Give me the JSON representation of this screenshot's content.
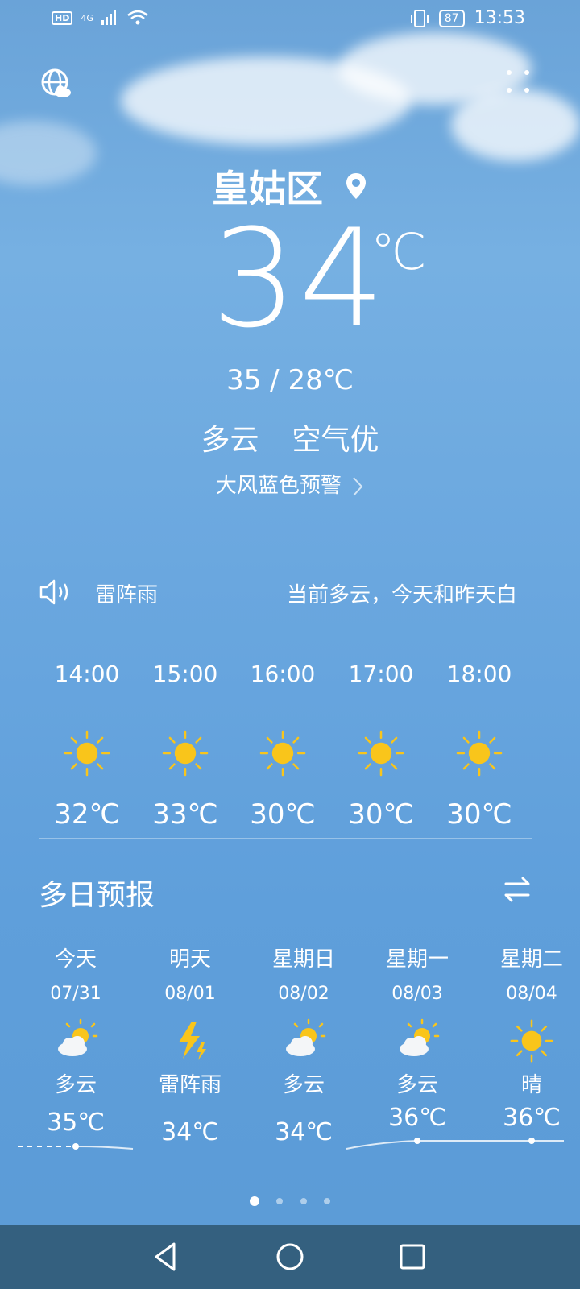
{
  "status": {
    "network_badge": "HD",
    "network_type": "4G",
    "battery": "87",
    "time": "13:53"
  },
  "location": {
    "city": "皇姑区"
  },
  "current": {
    "temp": "34",
    "unit": "℃",
    "range": "35 / 28℃",
    "condition": "多云",
    "air": "空气优",
    "alert": "大风蓝色预警"
  },
  "ticker": {
    "segment1": "雷阵雨",
    "segment2": "当前多云，今天和昨天白"
  },
  "hourly": [
    {
      "time": "14:00",
      "icon": "sun-icon",
      "temp": "32℃"
    },
    {
      "time": "15:00",
      "icon": "sun-icon",
      "temp": "33℃"
    },
    {
      "time": "16:00",
      "icon": "sun-icon",
      "temp": "30℃"
    },
    {
      "time": "17:00",
      "icon": "sun-icon",
      "temp": "30℃"
    },
    {
      "time": "18:00",
      "icon": "sun-icon",
      "temp": "30℃"
    }
  ],
  "daily_title": "多日预报",
  "daily": [
    {
      "name": "今天",
      "date": "07/31",
      "icon": "partly-cloudy-icon",
      "cond": "多云",
      "high": "35℃"
    },
    {
      "name": "明天",
      "date": "08/01",
      "icon": "thunder-icon",
      "cond": "雷阵雨",
      "high": "34℃"
    },
    {
      "name": "星期日",
      "date": "08/02",
      "icon": "partly-cloudy-icon",
      "cond": "多云",
      "high": "34℃"
    },
    {
      "name": "星期一",
      "date": "08/03",
      "icon": "partly-cloudy-icon",
      "cond": "多云",
      "high": "36℃"
    },
    {
      "name": "星期二",
      "date": "08/04",
      "icon": "sun-icon",
      "cond": "晴",
      "high": "36℃"
    }
  ],
  "colors": {
    "sun": "#f9c51b",
    "navbar": "#34607f",
    "sky": "#6aa7df"
  }
}
